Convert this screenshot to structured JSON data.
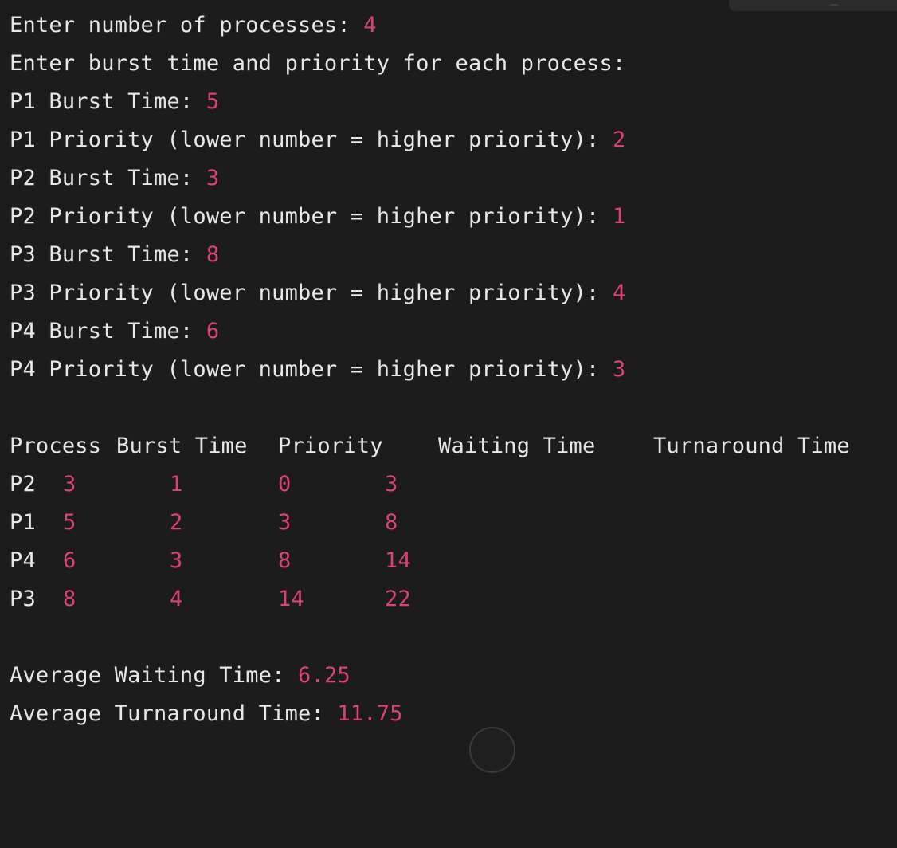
{
  "prompts": {
    "num_processes_label": "Enter number of processes: ",
    "num_processes_value": "4",
    "burst_priority_header": "Enter burst time and priority for each process:"
  },
  "inputs": [
    {
      "label": "P1 Burst Time: ",
      "value": "5"
    },
    {
      "label": "P1 Priority (lower number = higher priority): ",
      "value": "2"
    },
    {
      "label": "P2 Burst Time: ",
      "value": "3"
    },
    {
      "label": "P2 Priority (lower number = higher priority): ",
      "value": "1"
    },
    {
      "label": "P3 Burst Time: ",
      "value": "8"
    },
    {
      "label": "P3 Priority (lower number = higher priority): ",
      "value": "4"
    },
    {
      "label": "P4 Burst Time: ",
      "value": "6"
    },
    {
      "label": "P4 Priority (lower number = higher priority): ",
      "value": "3"
    }
  ],
  "table": {
    "headers": [
      "Process",
      "Burst Time",
      "Priority",
      "Waiting Time",
      "Turnaround Time"
    ],
    "rows": [
      [
        "P2",
        "3",
        "1",
        "0",
        "3"
      ],
      [
        "P1",
        "5",
        "2",
        "3",
        "8"
      ],
      [
        "P4",
        "6",
        "3",
        "8",
        "14"
      ],
      [
        "P3",
        "8",
        "4",
        "14",
        "22"
      ]
    ]
  },
  "summary": {
    "avg_waiting_label": "Average Waiting Time: ",
    "avg_waiting_value": "6.25",
    "avg_turnaround_label": "Average Turnaround Time: ",
    "avg_turnaround_value": "11.75"
  },
  "colors": {
    "background": "#1c1c1c",
    "text": "#e7e7e7",
    "value_accent": "#d8417a"
  }
}
